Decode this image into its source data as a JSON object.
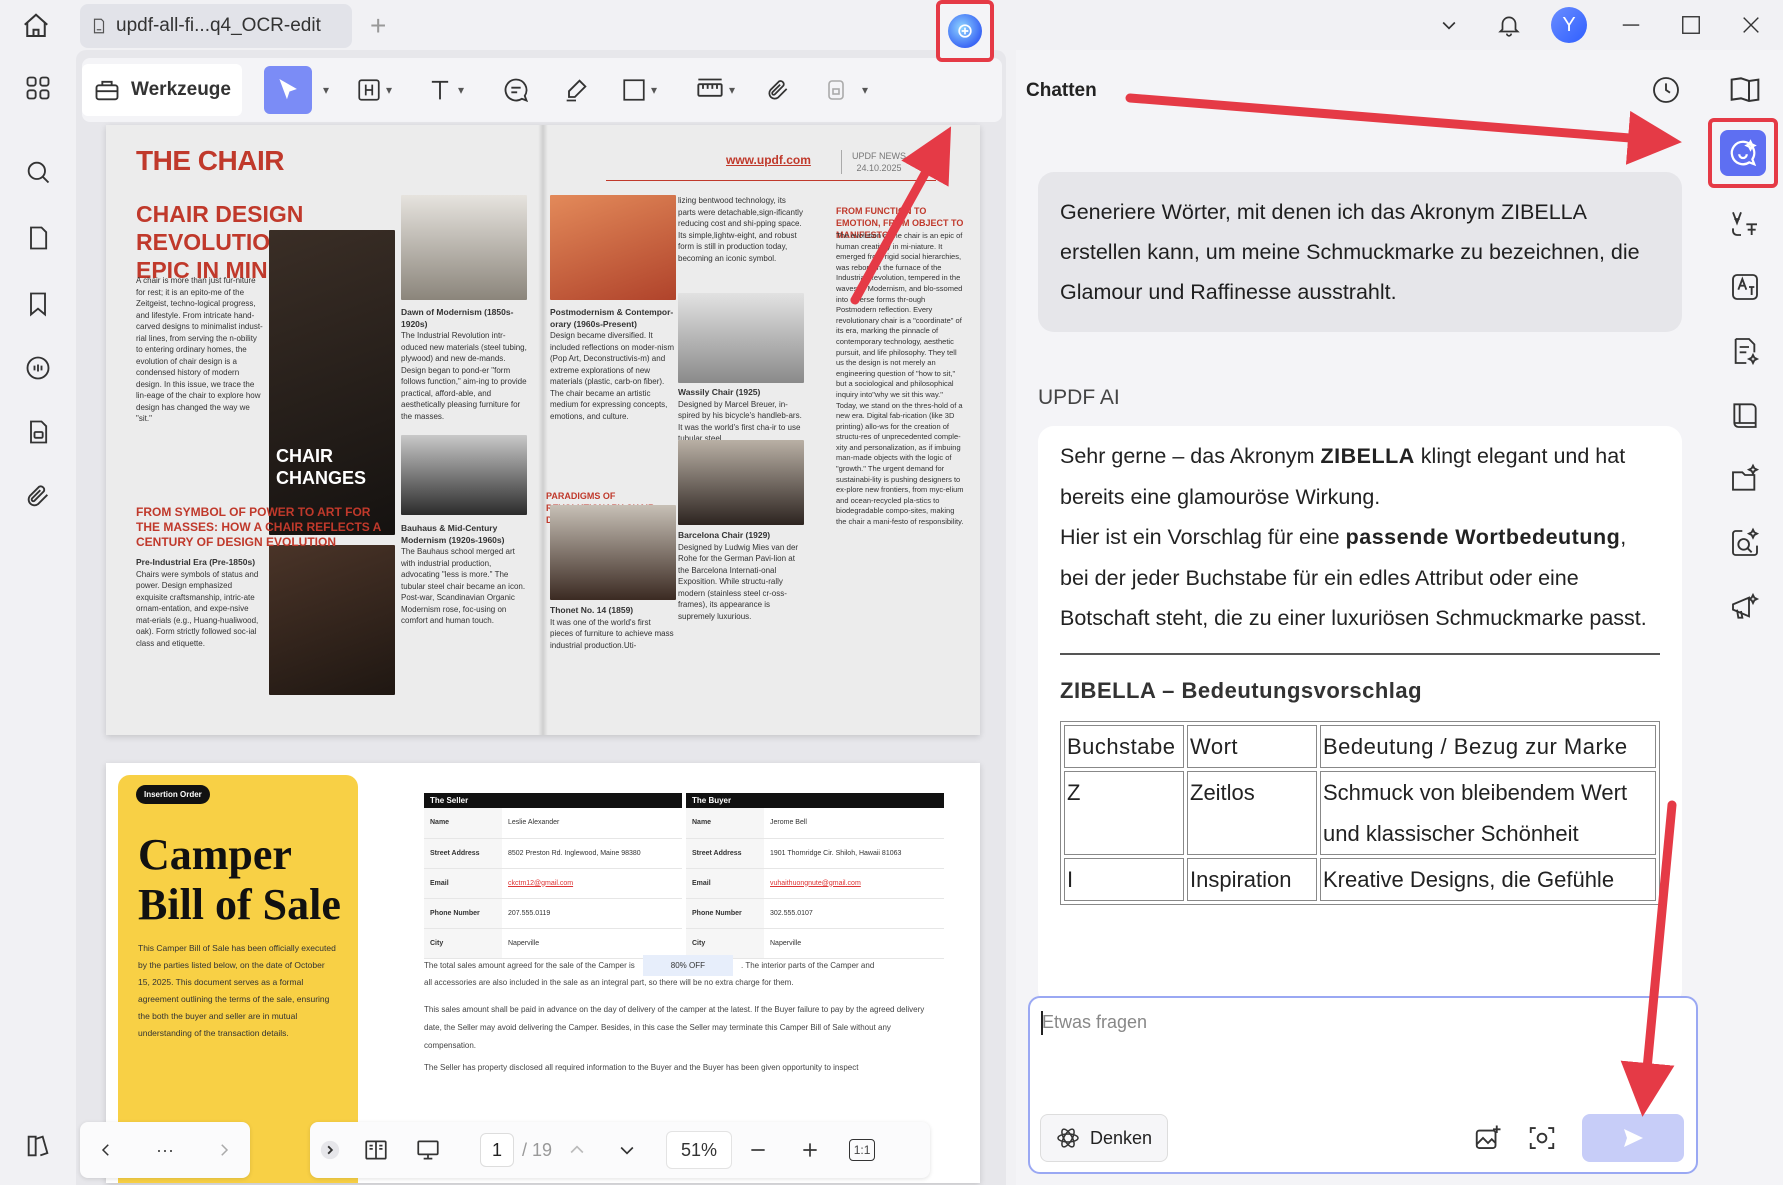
{
  "window": {
    "tab_title": "updf-all-fi...q4_OCR-edit",
    "avatar_letter": "Y"
  },
  "toolbar": {
    "tools_label": "Werkzeuge"
  },
  "magazine": {
    "title": "THE CHAIR",
    "url": "www.updf.com",
    "news_line1": "UPDF NEWS",
    "news_line2": "24.10.2025",
    "headline": "CHAIR DESIGN REVOLUTION: AN EPIC IN MINIATURE",
    "intro": "A chair is more than just fur-niture for rest; it is an epito-me of the Zeitgeist, techno-logical progress, and lifestyle. From intricate hand-carved designs to minimalist indust-rial lines, from serving the n-obility to entering ordinary homes, the evolution of chair design is a condensed history of modern design. In this issue, we trace the lin-eage of the chair to explore how design has changed the way we \"sit.\"",
    "hero_caption": "CHAIR CHANGES",
    "subhead": "FROM SYMBOL OF POWER TO ART FOR THE MASSES: HOW A CHAIR REFLECTS A CENTURY OF DESIGN EVOLUTION",
    "pre_industrial_title": "Pre-Industrial Era (Pre-1850s)",
    "pre_industrial_text": "Chairs were symbols of status and power. Design emphasized exquisite craftsmanship, intric-ate ornam-entation, and expe-nsive mat-erials (e.g., Huang-hualiwood, oak). Form strictly followed soc-ial class and etiquette.",
    "modernism_title": "Dawn of Modernism (1850s-1920s)",
    "modernism_text": "The Industrial Revolution intr-oduced new materials (steel tubing, plywood) and new de-mands. Design began to pond-er \"form follows function,\" aim-ing to provide practical, afford-able, and aesthetically pleasing furniture for the masses.",
    "bauhaus_title": "Bauhaus & Mid-Century Modernism (1920s-1960s)",
    "bauhaus_text": "The Bauhaus school merged art with industrial production, advocating \"less is more.\" The tubular steel chair became an icon. Post-war, Scandinavian Organic Modernism rose, foc-using on comfort and human touch.",
    "bentwood_text": "lizing bentwood technology, its parts were detachable,sign-ificantly reducing cost and shi-pping space. Its simple,lightw-eight, and robust form is still in production today, becoming an iconic symbol.",
    "postmodern_title": "Postmodernism & Contempor-orary (1960s-Present)",
    "postmodern_text": "Design became diversified. It included reflections on moder-nism (Pop Art, Deconstructivis-m) and extreme explorations of new materials (plastic, carb-on fiber). The chair became an artistic medium for expressing concepts, emotions, and culture.",
    "paradigms": "PARADIGMS OF REVOLUTIONARY CHAIR DESIGN",
    "thonet_title": "Thonet No. 14 (1859)",
    "thonet_text": "It was one of the world's first pieces of furniture to achieve mass industrial production.Uti-",
    "wassily_title": "Wassily Chair (1925)",
    "wassily_text": "Designed by Marcel Breuer, in-spired by his bicycle's handleb-ars. It was the world's first cha-ir to use tubular steel.",
    "barcelona_title": "Barcelona Chair (1929)",
    "barcelona_text": "Designed by Ludwig Mies van der Rohe for the German Pavi-lion at the Barcelona Internati-onal Exposition. While structu-rally modern (stainless steel cr-oss-frames), its appearance is supremely luxurious.",
    "manifesto_title": "FROM FUNCTION TO EMOTION, FROM OBJECT TO MANIFESTO",
    "manifesto_text": "The evolution of the chair is an epic of human creativity in mi-niature. It emerged from rigid social hierarchies, was reborn in the furnace of the Industrial Revolution, tempered in the waves of Modernism, and blo-ssomed into diverse forms thr-ough Postmodern reflection. Every revolutionary chair is a \"coordinate\" of its era, marking the pinnacle of contemporary technology, aesthetic pursuit, and life philosophy. They tell us the design is not merely an engineering question of \"how to sit,\" but a sociological and philosophical inquiry into\"why we sit this way.\" Today, we stand on the thres-hold of a new era. Digital fab-rication (like 3D printing) allo-ws for the creation of structu-res of unprecedented comple-xity and personalization, as if imbuing man-made objects with the logic of \"growth.\" The urgent demand for sustainabi-lity is pushing designers to ex-plore new frontiers, from myc-elium and ocean-recycled pla-stics to biodegradable compo-sites, making the chair a mani-festo of responsibility."
  },
  "bill": {
    "badge": "Insertion Order",
    "title_line1": "Camper",
    "title_line2": "Bill of Sale",
    "description": "This Camper Bill of Sale has been officially executed by the parties listed below, on the date of October 15, 2025. This document serves as a formal agreement outlining the terms of the sale, ensuring the both the buyer and seller are in mutual understanding of the transaction details.",
    "seller_header": "The Seller",
    "buyer_header": "The Buyer",
    "rows": [
      {
        "label": "Name",
        "seller": "Leslie Alexander",
        "buyer": "Jerome Bell"
      },
      {
        "label": "Street Address",
        "seller": "8502 Preston Rd. Inglewood, Maine 98380",
        "buyer": "1901 Thornridge Cir. Shiloh, Hawaii 81063"
      },
      {
        "label": "Email",
        "seller": "ckctm12@gmail.com",
        "buyer": "vuhaithuongnute@gmail.com"
      },
      {
        "label": "Phone Number",
        "seller": "207.555.0119",
        "buyer": "302.555.0107"
      },
      {
        "label": "City",
        "seller": "Naperville",
        "buyer": "Naperville"
      }
    ],
    "sale_text_a": "The total sales amount agreed for the sale of the Camper is",
    "discount": "80% OFF",
    "sale_text_b": ". The interior parts of the Camper and",
    "sale_text_c": "all accessories are also included in the sale as an integral part, so there will be no extra charge for them.",
    "advance_text": "This sales amount shall be paid in advance on the day of delivery of the camper at the latest. If the Buyer failure to pay by the agreed delivery date, the Seller may avoid delivering the Camper. Besides, in this case the Seller may terminate this Camper Bill of Sale without any compensation.",
    "disclosed_text": "The Seller has property disclosed all required information to the Buyer and the Buyer has been given opportunity to inspect"
  },
  "nav": {
    "current_page": "1",
    "total_pages": "/ 19",
    "zoom": "51%",
    "more": "···",
    "actual_size": "1:1"
  },
  "chat": {
    "title": "Chatten",
    "user_message": "Generiere Wörter, mit denen ich das Akronym ZIBELLA erstellen kann, um meine Schmuckmarke zu bezeichnen, die Glamour und Raffinesse ausstrahlt.",
    "ai_label": "UPDF AI",
    "ai_p1_a": "Sehr gerne – das Akronym ",
    "ai_p1_b": "ZIBELLA",
    "ai_p1_c": " klingt elegant und hat bereits eine glamouröse Wirkung.",
    "ai_p2_a": "Hier ist ein Vorschlag für eine ",
    "ai_p2_b": "passende Wortbedeutung",
    "ai_p2_c": ", bei der jeder Buchstabe für ein edles Attribut oder eine Botschaft steht, die zu einer luxuriösen Schmuckmarke passt.",
    "ai_heading": "ZIBELLA – Bedeutungsvorschlag",
    "table_headers": [
      "Buchstabe",
      "Wort",
      "Bedeutung / Bezug zur Marke"
    ],
    "table_rows": [
      [
        "Z",
        "Zeitlos",
        "Schmuck von bleibendem Wert und klassischer Schönheit"
      ],
      [
        "I",
        "Inspiration",
        "Kreative Designs, die Gefühle"
      ]
    ],
    "input_placeholder": "Etwas fragen",
    "think_label": "Denken"
  },
  "colors": {
    "annotation_red": "#e53a46",
    "accent_blue": "#5e6ff2",
    "magazine_red": "#c0392b",
    "bill_yellow": "#f8d045"
  }
}
